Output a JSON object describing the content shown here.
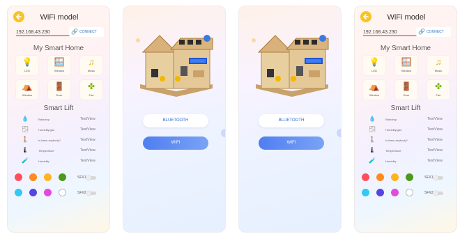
{
  "screens": [
    {
      "kind": "control",
      "title": "WiFi model",
      "ip": "192.168.43.230",
      "connect": "CONNECT",
      "smart_home_title": "My Smart Home",
      "devices": [
        {
          "label": "LED",
          "icon": "bulb-icon"
        },
        {
          "label": "Window",
          "icon": "window-icon"
        },
        {
          "label": "Music",
          "icon": "music-icon"
        },
        {
          "label": "Window",
          "icon": "curtain-icon"
        },
        {
          "label": "Door",
          "icon": "door-icon"
        },
        {
          "label": "Fan",
          "icon": "fan-icon"
        }
      ],
      "smart_lift_title": "Smart Lift",
      "sensors": [
        {
          "label": "Raindrop",
          "value": "TextView",
          "icon": "raindrop-icon"
        },
        {
          "label": "Humidity/gas",
          "value": "TextView",
          "icon": "gas-icon"
        },
        {
          "label": "Is there anybody?",
          "value": "TextView",
          "icon": "person-icon"
        },
        {
          "label": "Temperature",
          "value": "TextView",
          "icon": "thermometer-icon"
        },
        {
          "label": "Humidity",
          "value": "TextView",
          "icon": "humidity-icon"
        }
      ],
      "colors_row1": [
        "#ff4f5b",
        "#ff8a1e",
        "#ffb31f",
        "#4c9a1d"
      ],
      "colors_row2": [
        "#33c9f2",
        "#5546e2",
        "#e449dd",
        "#ffffff"
      ],
      "sfx1": "SFX1",
      "sfx2": "SFX2"
    },
    {
      "kind": "connect",
      "bluetooth": "BLUETOOTH",
      "wifi": "WIFI"
    },
    {
      "kind": "connect",
      "bluetooth": "BLUETOOTH",
      "wifi": "WIFI"
    },
    {
      "kind": "control",
      "title": "WiFi model",
      "ip": "192.168.43.230",
      "connect": "CONNECT",
      "smart_home_title": "My Smart Home",
      "devices": [
        {
          "label": "LED",
          "icon": "bulb-icon"
        },
        {
          "label": "Window",
          "icon": "window-icon"
        },
        {
          "label": "Music",
          "icon": "music-icon"
        },
        {
          "label": "Window",
          "icon": "curtain-icon"
        },
        {
          "label": "Door",
          "icon": "door-icon"
        },
        {
          "label": "Fan",
          "icon": "fan-icon"
        }
      ],
      "smart_lift_title": "Smart Lift",
      "sensors": [
        {
          "label": "Raindrop",
          "value": "TextView",
          "icon": "raindrop-icon"
        },
        {
          "label": "Humidity/gas",
          "value": "TextView",
          "icon": "gas-icon"
        },
        {
          "label": "Is there anybody?",
          "value": "TextView",
          "icon": "person-icon"
        },
        {
          "label": "Temperature",
          "value": "TextView",
          "icon": "thermometer-icon"
        },
        {
          "label": "Humidity",
          "value": "TextView",
          "icon": "humidity-icon"
        }
      ],
      "colors_row1": [
        "#ff4f5b",
        "#ff8a1e",
        "#ffb31f",
        "#4c9a1d"
      ],
      "colors_row2": [
        "#33c9f2",
        "#5546e2",
        "#e449dd",
        "#ffffff"
      ],
      "sfx1": "SFX1",
      "sfx2": "SFX2"
    }
  ]
}
